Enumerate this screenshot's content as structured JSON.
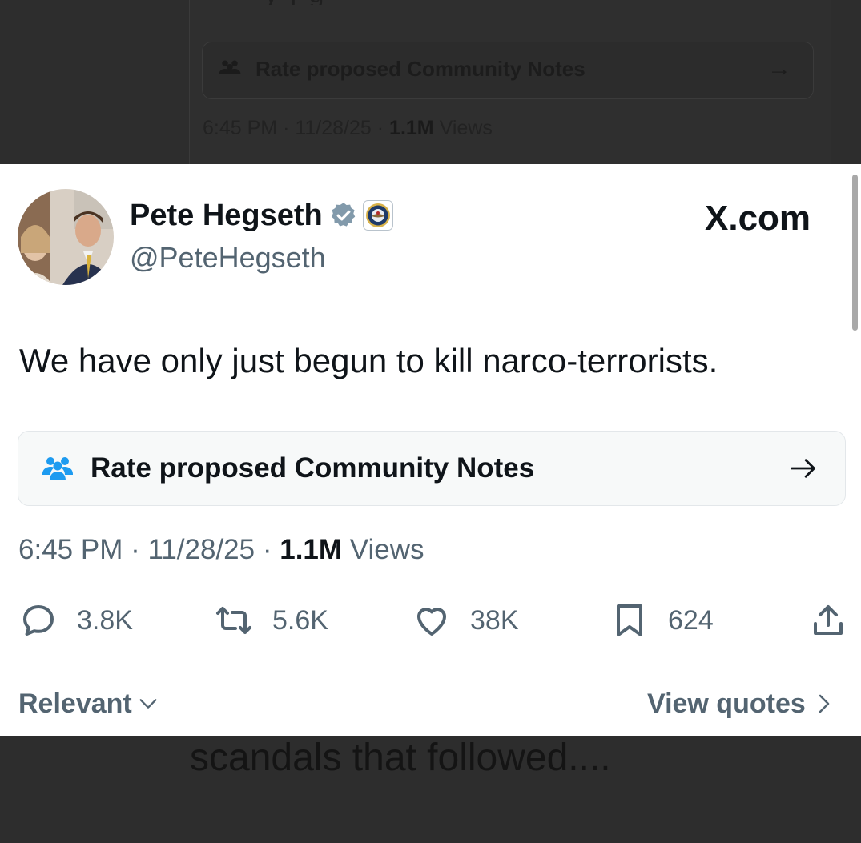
{
  "background_tweet": {
    "notes_label": "Rate proposed Community Notes",
    "time": "6:45 PM",
    "date": "11/28/25",
    "views_count": "1.1M",
    "views_label": "Views"
  },
  "tweet": {
    "author_name": "Pete Hegseth",
    "handle": "@PeteHegseth",
    "source": "X.com",
    "text": "We have only just begun to kill narco-terrorists.",
    "community_notes_label": "Rate proposed Community Notes",
    "time": "6:45 PM",
    "separator": " · ",
    "date": "11/28/25",
    "views_count": "1.1M",
    "views_label": "Views",
    "stats": {
      "replies": "3.8K",
      "reposts": "5.6K",
      "likes": "38K",
      "bookmarks": "624"
    },
    "sort_label": "Relevant",
    "view_quotes_label": "View quotes"
  },
  "caption": "scandals that followed....",
  "colors": {
    "text_primary": "#0f1419",
    "text_secondary": "#536471",
    "accent_blue": "#1d9bf0",
    "overlay": "#2d2d2d"
  },
  "icons": {
    "verified": "verified-badge-icon",
    "affiliate": "dod-seal-icon",
    "notes": "community-notes-icon",
    "reply": "reply-icon",
    "repost": "repost-icon",
    "like": "heart-icon",
    "bookmark": "bookmark-icon",
    "share": "share-icon"
  }
}
